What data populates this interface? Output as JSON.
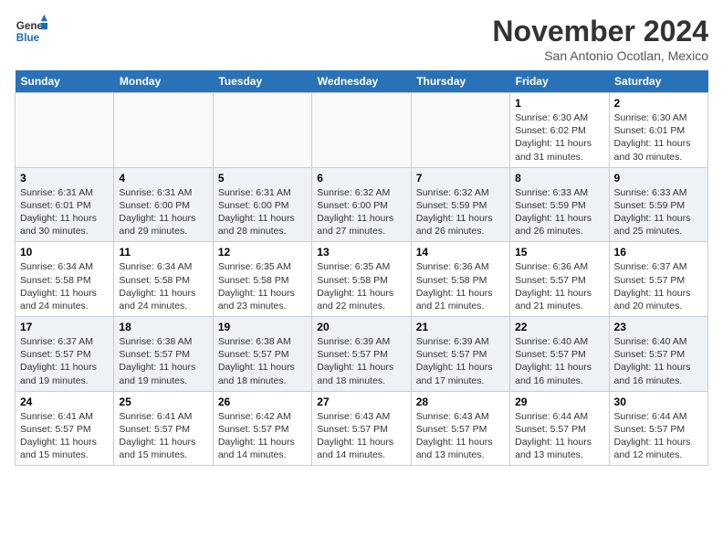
{
  "logo": {
    "line1": "General",
    "line2": "Blue"
  },
  "title": "November 2024",
  "location": "San Antonio Ocotlan, Mexico",
  "weekdays": [
    "Sunday",
    "Monday",
    "Tuesday",
    "Wednesday",
    "Thursday",
    "Friday",
    "Saturday"
  ],
  "weeks": [
    [
      {
        "day": "",
        "info": ""
      },
      {
        "day": "",
        "info": ""
      },
      {
        "day": "",
        "info": ""
      },
      {
        "day": "",
        "info": ""
      },
      {
        "day": "",
        "info": ""
      },
      {
        "day": "1",
        "info": "Sunrise: 6:30 AM\nSunset: 6:02 PM\nDaylight: 11 hours and 31 minutes."
      },
      {
        "day": "2",
        "info": "Sunrise: 6:30 AM\nSunset: 6:01 PM\nDaylight: 11 hours and 30 minutes."
      }
    ],
    [
      {
        "day": "3",
        "info": "Sunrise: 6:31 AM\nSunset: 6:01 PM\nDaylight: 11 hours and 30 minutes."
      },
      {
        "day": "4",
        "info": "Sunrise: 6:31 AM\nSunset: 6:00 PM\nDaylight: 11 hours and 29 minutes."
      },
      {
        "day": "5",
        "info": "Sunrise: 6:31 AM\nSunset: 6:00 PM\nDaylight: 11 hours and 28 minutes."
      },
      {
        "day": "6",
        "info": "Sunrise: 6:32 AM\nSunset: 6:00 PM\nDaylight: 11 hours and 27 minutes."
      },
      {
        "day": "7",
        "info": "Sunrise: 6:32 AM\nSunset: 5:59 PM\nDaylight: 11 hours and 26 minutes."
      },
      {
        "day": "8",
        "info": "Sunrise: 6:33 AM\nSunset: 5:59 PM\nDaylight: 11 hours and 26 minutes."
      },
      {
        "day": "9",
        "info": "Sunrise: 6:33 AM\nSunset: 5:59 PM\nDaylight: 11 hours and 25 minutes."
      }
    ],
    [
      {
        "day": "10",
        "info": "Sunrise: 6:34 AM\nSunset: 5:58 PM\nDaylight: 11 hours and 24 minutes."
      },
      {
        "day": "11",
        "info": "Sunrise: 6:34 AM\nSunset: 5:58 PM\nDaylight: 11 hours and 24 minutes."
      },
      {
        "day": "12",
        "info": "Sunrise: 6:35 AM\nSunset: 5:58 PM\nDaylight: 11 hours and 23 minutes."
      },
      {
        "day": "13",
        "info": "Sunrise: 6:35 AM\nSunset: 5:58 PM\nDaylight: 11 hours and 22 minutes."
      },
      {
        "day": "14",
        "info": "Sunrise: 6:36 AM\nSunset: 5:58 PM\nDaylight: 11 hours and 21 minutes."
      },
      {
        "day": "15",
        "info": "Sunrise: 6:36 AM\nSunset: 5:57 PM\nDaylight: 11 hours and 21 minutes."
      },
      {
        "day": "16",
        "info": "Sunrise: 6:37 AM\nSunset: 5:57 PM\nDaylight: 11 hours and 20 minutes."
      }
    ],
    [
      {
        "day": "17",
        "info": "Sunrise: 6:37 AM\nSunset: 5:57 PM\nDaylight: 11 hours and 19 minutes."
      },
      {
        "day": "18",
        "info": "Sunrise: 6:38 AM\nSunset: 5:57 PM\nDaylight: 11 hours and 19 minutes."
      },
      {
        "day": "19",
        "info": "Sunrise: 6:38 AM\nSunset: 5:57 PM\nDaylight: 11 hours and 18 minutes."
      },
      {
        "day": "20",
        "info": "Sunrise: 6:39 AM\nSunset: 5:57 PM\nDaylight: 11 hours and 18 minutes."
      },
      {
        "day": "21",
        "info": "Sunrise: 6:39 AM\nSunset: 5:57 PM\nDaylight: 11 hours and 17 minutes."
      },
      {
        "day": "22",
        "info": "Sunrise: 6:40 AM\nSunset: 5:57 PM\nDaylight: 11 hours and 16 minutes."
      },
      {
        "day": "23",
        "info": "Sunrise: 6:40 AM\nSunset: 5:57 PM\nDaylight: 11 hours and 16 minutes."
      }
    ],
    [
      {
        "day": "24",
        "info": "Sunrise: 6:41 AM\nSunset: 5:57 PM\nDaylight: 11 hours and 15 minutes."
      },
      {
        "day": "25",
        "info": "Sunrise: 6:41 AM\nSunset: 5:57 PM\nDaylight: 11 hours and 15 minutes."
      },
      {
        "day": "26",
        "info": "Sunrise: 6:42 AM\nSunset: 5:57 PM\nDaylight: 11 hours and 14 minutes."
      },
      {
        "day": "27",
        "info": "Sunrise: 6:43 AM\nSunset: 5:57 PM\nDaylight: 11 hours and 14 minutes."
      },
      {
        "day": "28",
        "info": "Sunrise: 6:43 AM\nSunset: 5:57 PM\nDaylight: 11 hours and 13 minutes."
      },
      {
        "day": "29",
        "info": "Sunrise: 6:44 AM\nSunset: 5:57 PM\nDaylight: 11 hours and 13 minutes."
      },
      {
        "day": "30",
        "info": "Sunrise: 6:44 AM\nSunset: 5:57 PM\nDaylight: 11 hours and 12 minutes."
      }
    ]
  ]
}
